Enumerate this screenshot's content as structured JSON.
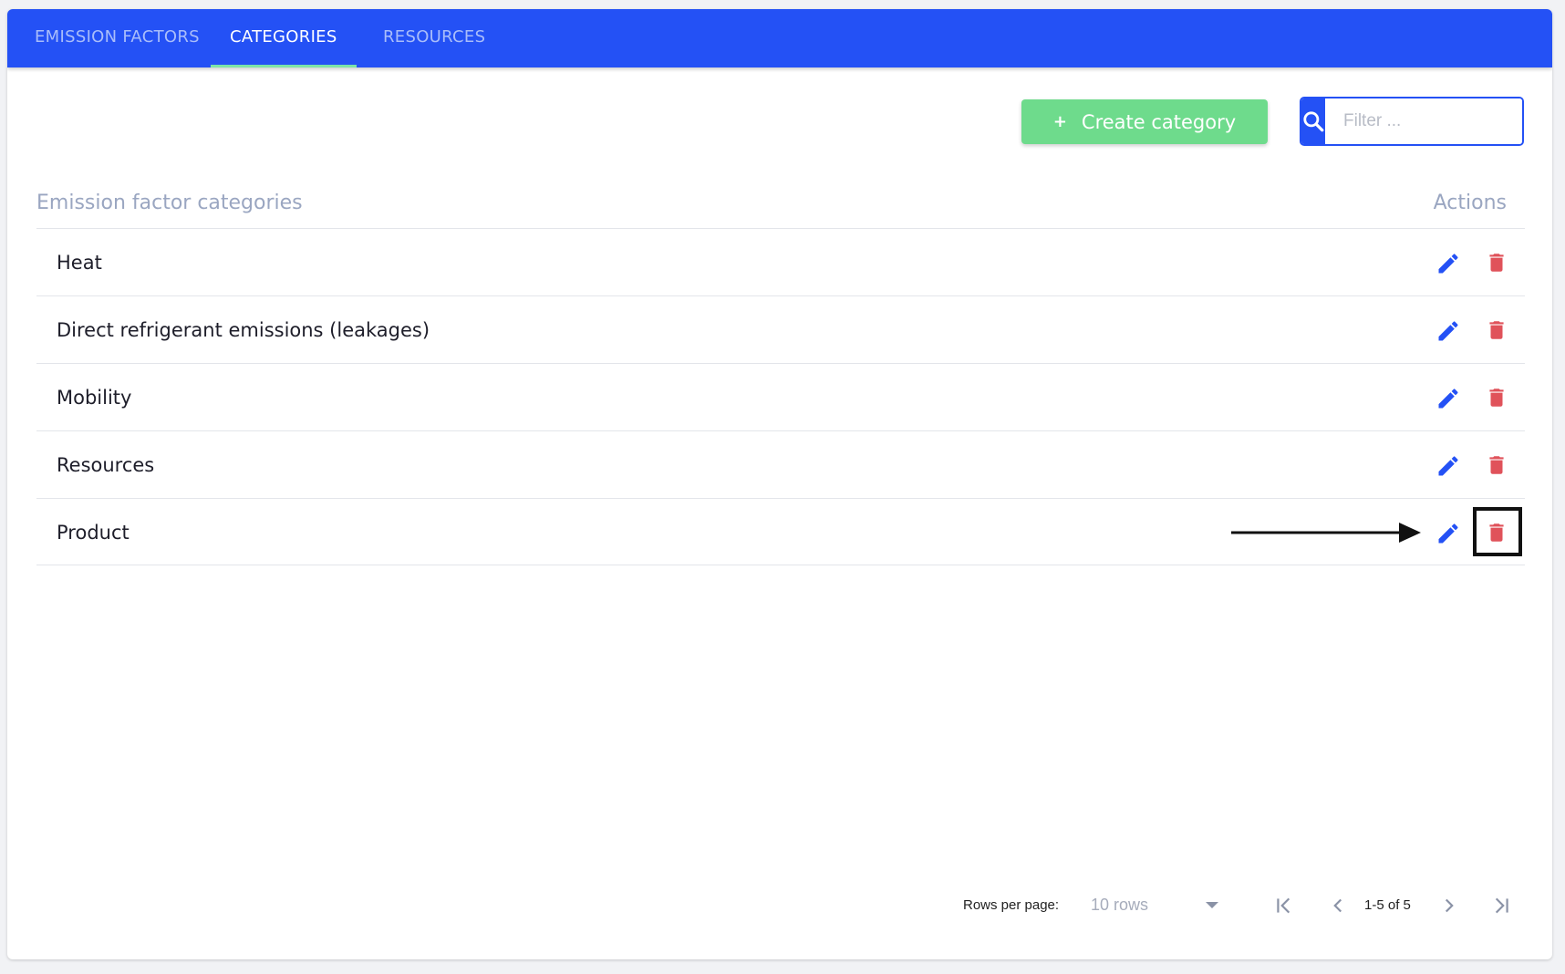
{
  "tabs": [
    {
      "label": "EMISSION FACTORS",
      "active": false
    },
    {
      "label": "CATEGORIES",
      "active": true
    },
    {
      "label": "RESOURCES",
      "active": false
    }
  ],
  "toolbar": {
    "create_label": "Create category",
    "create_icon": "plus-icon",
    "filter_placeholder": "Filter ...",
    "search_icon": "search-icon"
  },
  "table": {
    "header_title": "Emission factor categories",
    "header_actions": "Actions",
    "rows": [
      {
        "name": "Heat"
      },
      {
        "name": "Direct refrigerant emissions (leakages)"
      },
      {
        "name": "Mobility"
      },
      {
        "name": "Resources"
      },
      {
        "name": "Product"
      }
    ],
    "edit_icon": "pencil-icon",
    "delete_icon": "trash-icon"
  },
  "pagination": {
    "rows_per_page_label": "Rows per page:",
    "rows_per_page_value": "10 rows",
    "range": "1-5 of 5"
  },
  "colors": {
    "primary": "#2451f5",
    "create_button": "#6edb8c",
    "delete": "#e0525a",
    "tab_indicator": "#7de3a8",
    "header_text": "#9aa6c1"
  }
}
